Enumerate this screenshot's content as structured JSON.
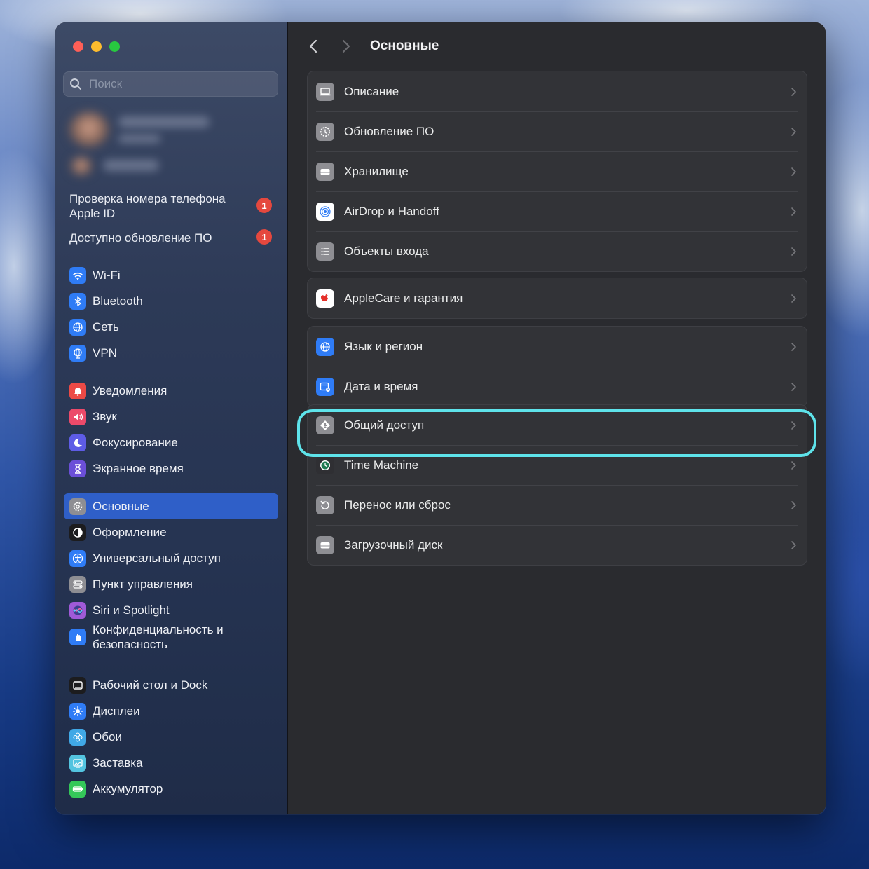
{
  "window": {
    "title": "Основные"
  },
  "search": {
    "placeholder": "Поиск"
  },
  "notices": [
    {
      "label": "Проверка номера телефона Apple ID",
      "badge": "1"
    },
    {
      "label": "Доступно обновление ПО",
      "badge": "1"
    }
  ],
  "sidebar": {
    "items": [
      {
        "label": "Wi-Fi",
        "icon": "wifi-icon",
        "color": "#2f7cf6"
      },
      {
        "label": "Bluetooth",
        "icon": "bluetooth-icon",
        "color": "#2f7cf6"
      },
      {
        "label": "Сеть",
        "icon": "globe-icon",
        "color": "#2f7cf6"
      },
      {
        "label": "VPN",
        "icon": "vpn-globe-icon",
        "color": "#2f7cf6"
      },
      {
        "label": "Уведомления",
        "icon": "bell-icon",
        "color": "#ec4a46"
      },
      {
        "label": "Звук",
        "icon": "speaker-icon",
        "color": "#ec4a6a"
      },
      {
        "label": "Фокусирование",
        "icon": "moon-icon",
        "color": "#5e5ce6"
      },
      {
        "label": "Экранное время",
        "icon": "hourglass-icon",
        "color": "#6b4fd8"
      },
      {
        "label": "Основные",
        "icon": "gear-icon",
        "color": "#8e8e93",
        "selected": true
      },
      {
        "label": "Оформление",
        "icon": "appearance-icon",
        "color": "#1c1c1e"
      },
      {
        "label": "Универсальный доступ",
        "icon": "accessibility-icon",
        "color": "#2f7cf6"
      },
      {
        "label": "Пункт управления",
        "icon": "control-center-icon",
        "color": "#8e8e93"
      },
      {
        "label": "Siri и Spotlight",
        "icon": "siri-icon",
        "color": "#a05ad8"
      },
      {
        "label": "Конфиденциальность и безопасность",
        "icon": "hand-icon",
        "color": "#2f7cf6"
      },
      {
        "label": "Рабочий стол и Dock",
        "icon": "dock-icon",
        "color": "#1c1c1e"
      },
      {
        "label": "Дисплеи",
        "icon": "sun-icon",
        "color": "#2f7cf6"
      },
      {
        "label": "Обои",
        "icon": "flower-icon",
        "color": "#40a8e6"
      },
      {
        "label": "Заставка",
        "icon": "screensaver-icon",
        "color": "#53c4e0"
      },
      {
        "label": "Аккумулятор",
        "icon": "battery-icon",
        "color": "#34c759"
      }
    ]
  },
  "main": {
    "groups": [
      [
        {
          "label": "Описание",
          "icon": "laptop-icon"
        },
        {
          "label": "Обновление ПО",
          "icon": "software-update-icon"
        },
        {
          "label": "Хранилище",
          "icon": "storage-icon"
        },
        {
          "label": "AirDrop и Handoff",
          "icon": "airdrop-icon"
        },
        {
          "label": "Объекты входа",
          "icon": "login-items-icon"
        }
      ],
      [
        {
          "label": "AppleCare и гарантия",
          "icon": "apple-icon"
        }
      ],
      [
        {
          "label": "Язык и регион",
          "icon": "language-globe-icon"
        },
        {
          "label": "Дата и время",
          "icon": "calendar-clock-icon"
        }
      ],
      [
        {
          "label": "Общий доступ",
          "icon": "sharing-icon",
          "highlighted": true
        },
        {
          "label": "Time Machine",
          "icon": "time-machine-icon"
        },
        {
          "label": "Перенос или сброс",
          "icon": "reset-icon"
        },
        {
          "label": "Загрузочный диск",
          "icon": "startup-disk-icon"
        }
      ]
    ],
    "highlight_color": "#5ee3ea"
  }
}
